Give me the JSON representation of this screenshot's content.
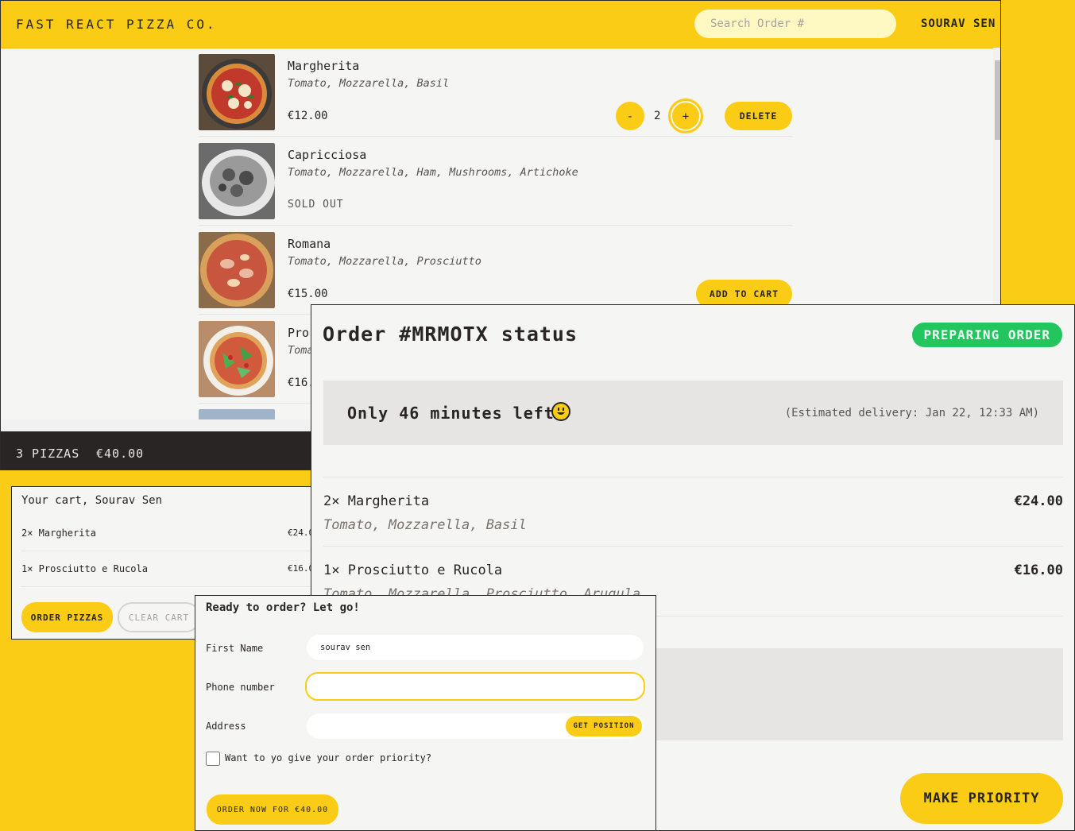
{
  "menu_window": {
    "header": {
      "brand": "FAST REACT PIZZA CO.",
      "search_placeholder": "Search Order #",
      "username": "SOURAV SEN"
    },
    "pizzas": [
      {
        "name": "Margherita",
        "ingredients": "Tomato, Mozzarella, Basil",
        "price": "€12.00",
        "in_cart": true,
        "quantity": "2",
        "decrease_label": "-",
        "increase_label": "+",
        "delete_label": "DELETE"
      },
      {
        "name": "Capricciosa",
        "ingredients": "Tomato, Mozzarella, Ham, Mushrooms, Artichoke",
        "status": "SOLD OUT"
      },
      {
        "name": "Romana",
        "ingredients": "Tomato, Mozzarella, Prosciutto",
        "price": "€15.00",
        "add_label": "ADD TO CART"
      },
      {
        "name": "Pro",
        "ingredients": "Toma",
        "price": "€16."
      }
    ],
    "cart_overview": {
      "count": "3 PIZZAS",
      "total": "€40.00"
    }
  },
  "cart_window": {
    "heading": "Your cart, Sourav Sen",
    "items": [
      {
        "label": "2× Margherita",
        "price": "€24.0"
      },
      {
        "label": "1× Prosciutto e Rucola",
        "price": "€16.0"
      }
    ],
    "order_button": "ORDER PIZZAS",
    "clear_button": "CLEAR CART"
  },
  "order_window": {
    "title": "Order #MRMOTX status",
    "status_badge": "PREPARING ORDER",
    "time_left": "Only 46 minutes left",
    "estimated_delivery": "(Estimated delivery: Jan 22, 12:33 AM)",
    "items": [
      {
        "label": "2× Margherita",
        "price": "€24.00",
        "ingredients": "Tomato, Mozzarella, Basil"
      },
      {
        "label": "1× Prosciutto e Rucola",
        "price": "€16.00",
        "ingredients": "Tomato, Mozzarella, Prosciutto, Arugula"
      }
    ],
    "make_priority_button": "MAKE PRIORITY"
  },
  "form_window": {
    "heading": "Ready to order? Let go!",
    "first_name_label": "First Name",
    "first_name_value": "sourav sen",
    "phone_label": "Phone number",
    "phone_value": "",
    "address_label": "Address",
    "address_value": "",
    "get_position_button": "GET POSITION",
    "priority_label": "Want to yo give your order priority?",
    "priority_checked": false,
    "submit_button": "ORDER NOW FOR €40.00"
  },
  "colors": {
    "accent_yellow": "#facc15",
    "status_green": "#22c55e",
    "dark_bar": "#292524",
    "panel_bg": "#f5f5f4"
  }
}
